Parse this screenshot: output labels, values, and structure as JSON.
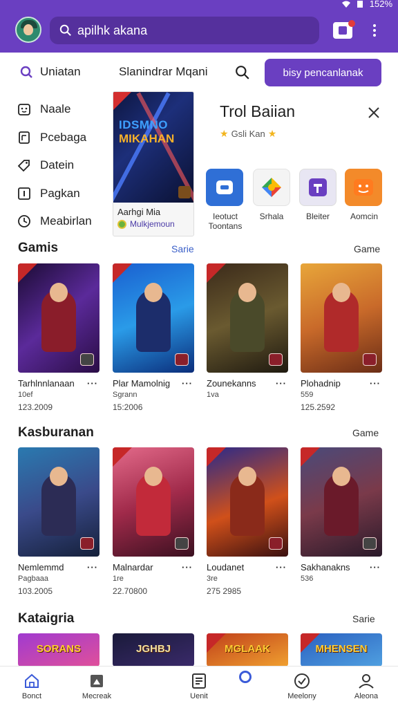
{
  "status_bar": {
    "battery_text": "152%"
  },
  "app_bar": {
    "search_text": "apilhk akana",
    "icons": [
      "avatar",
      "search-icon",
      "cart-icon",
      "more-vert-icon"
    ]
  },
  "top_row": {
    "tab1_label": "Uniatan",
    "tab2_label": "Slanindrar Mqani",
    "primary_button": "bisy pencanlanak"
  },
  "sidebar": {
    "items": [
      {
        "label": "Naale",
        "icon": "face-icon"
      },
      {
        "label": "Pcebaga",
        "icon": "document-icon"
      },
      {
        "label": "Datein",
        "icon": "tag-icon"
      },
      {
        "label": "Pagkan",
        "icon": "info-icon"
      },
      {
        "label": "Meabirlan",
        "icon": "clock-icon"
      }
    ]
  },
  "featured": {
    "art_line1": "IDSMNO",
    "art_line2": "MIKAHAN",
    "title": "Aarhgi Mia",
    "subtitle": "Mulkjemoun"
  },
  "panel": {
    "title": "Trol Baiian",
    "rating_text": "Gsli Kan",
    "apps": [
      {
        "label": "Ieotuct Toontans",
        "color": "#2f6fd6"
      },
      {
        "label": "Srhala",
        "color": "#f4f4f4"
      },
      {
        "label": "Bleiter",
        "color": "#e8e6f3"
      },
      {
        "label": "Aomcin",
        "color": "#f38a2a"
      }
    ]
  },
  "sections": [
    {
      "title": "Gamis",
      "mid_link": "Sarie",
      "right_link": "Game",
      "items": [
        {
          "name": "Tarhlnnlanaan",
          "meta": "10ef",
          "meta2": "123.2009"
        },
        {
          "name": "Plar Mamolnig",
          "meta": "Sgrann",
          "meta2": "15:2006"
        },
        {
          "name": "Zounekanns",
          "meta": "1va",
          "meta2": ""
        },
        {
          "name": "Plohadnip",
          "meta": "559",
          "meta2": "125.2592"
        }
      ]
    },
    {
      "title": "Kasburanan",
      "mid_link": "",
      "right_link": "Game",
      "items": [
        {
          "name": "Nemlemmd",
          "meta": "Pagbaaa",
          "meta2": "103.2005"
        },
        {
          "name": "Malnardar",
          "meta": "1re",
          "meta2": "22.70800"
        },
        {
          "name": "Loudanet",
          "meta": "3re",
          "meta2": "275 2985"
        },
        {
          "name": "Sakhanakns",
          "meta": "536",
          "meta2": ""
        }
      ]
    },
    {
      "title": "Kataigria",
      "mid_link": "",
      "right_link": "Sarie",
      "items": [
        {
          "name": "",
          "logo": "SORANS"
        },
        {
          "name": "",
          "logo": "JGHBJ"
        },
        {
          "name": "",
          "logo": "MGLAAK"
        },
        {
          "name": "",
          "logo": "MHENSEN"
        }
      ]
    }
  ],
  "bottom_nav": {
    "items": [
      {
        "label": "Bonct",
        "icon": "home-icon"
      },
      {
        "label": "Mecreak",
        "icon": "image-icon"
      },
      {
        "label": "Uenit",
        "icon": "grid-icon"
      },
      {
        "label": "Meelony",
        "icon": "check-badge-icon"
      },
      {
        "label": "Aleona",
        "icon": "profile-icon"
      }
    ]
  },
  "colors": {
    "primary": "#6a3fc1",
    "primary_dark": "#55309d",
    "corner_red": "#c62828"
  }
}
